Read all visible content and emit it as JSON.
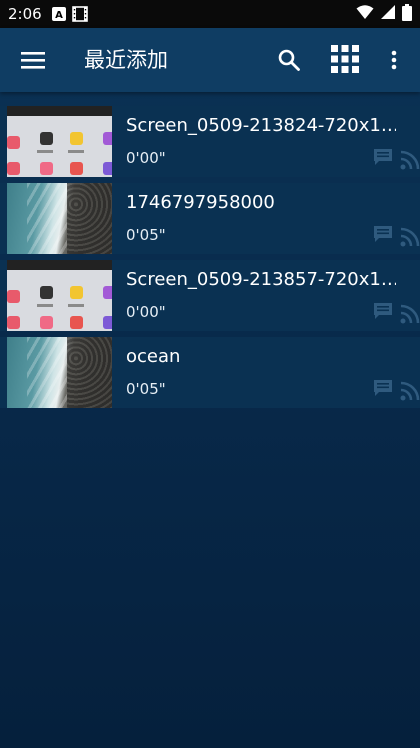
{
  "status_bar": {
    "time": "2:06",
    "icons": [
      "a-notification-icon",
      "film-notification-icon",
      "wifi-icon",
      "cellular-signal-icon",
      "battery-icon"
    ]
  },
  "app_bar": {
    "title": "最近添加",
    "icons": [
      "menu-icon",
      "search-icon",
      "grid-view-icon",
      "more-vert-icon"
    ]
  },
  "videos": [
    {
      "name": "Screen_0509-213824-720x1…",
      "duration": "0'00\"",
      "thumb": "screen"
    },
    {
      "name": "1746797958000",
      "duration": "0'05\"",
      "thumb": "ocean"
    },
    {
      "name": "Screen_0509-213857-720x1…",
      "duration": "0'00\"",
      "thumb": "screen"
    },
    {
      "name": "ocean",
      "duration": "0'05\"",
      "thumb": "ocean"
    }
  ],
  "colors": {
    "app_bar": "#0f3d63",
    "background": "#08294a",
    "item_background": "#0a3152",
    "status_bar": "#0a0a0a"
  }
}
